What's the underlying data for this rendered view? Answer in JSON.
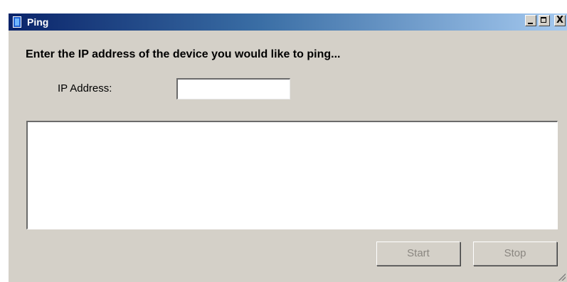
{
  "window": {
    "title": "Ping",
    "controls": {
      "minimize_label": "_",
      "maximize_label": "□",
      "close_label": "X"
    }
  },
  "main": {
    "prompt": "Enter the IP address of the device you would like to ping...",
    "ip_label": "IP Address:",
    "ip_value": "",
    "output_text": ""
  },
  "buttons": {
    "start_label": "Start",
    "stop_label": "Stop",
    "start_enabled": false,
    "stop_enabled": false
  },
  "colors": {
    "titlebar_start": "#0a246a",
    "titlebar_end": "#a6caf0",
    "window_bg": "#d4d0c8",
    "disabled_text": "#8a8680"
  }
}
